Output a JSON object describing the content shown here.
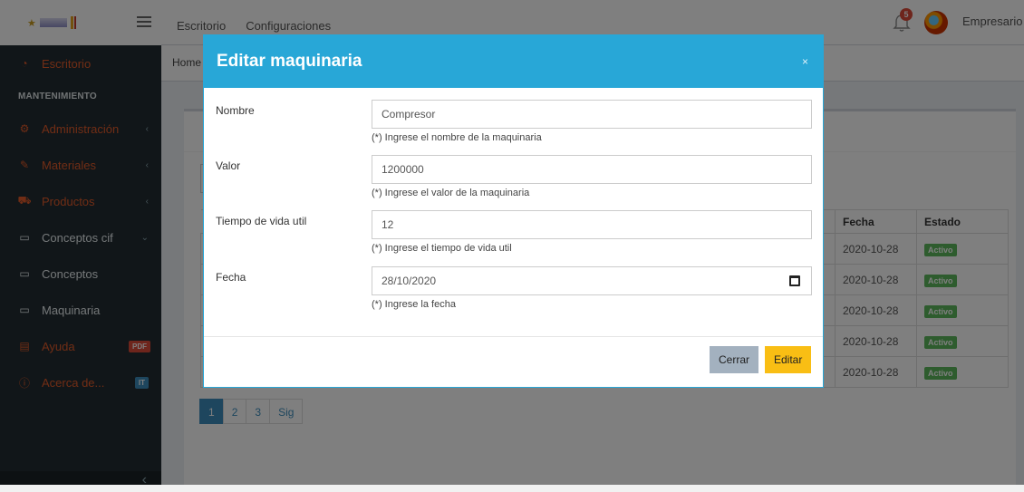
{
  "header": {
    "nav": [
      "Escritorio",
      "Configuraciones"
    ],
    "notification_count": "5",
    "user_label": "Empresario ▾"
  },
  "sidebar": {
    "items": [
      {
        "label": "Escritorio",
        "icon": "dashboard-icon"
      },
      {
        "section": "MANTENIMIENTO"
      },
      {
        "label": "Administración",
        "icon": "gear-icon"
      },
      {
        "label": "Materiales",
        "icon": "brush-icon"
      },
      {
        "label": "Productos",
        "icon": "cart-icon"
      },
      {
        "label": "Conceptos cif",
        "icon": "folder-icon"
      },
      {
        "label": "Conceptos",
        "icon": "folder-icon"
      },
      {
        "label": "Maquinaria",
        "icon": "folder-icon"
      },
      {
        "label": "Ayuda",
        "icon": "book-icon",
        "tag": "PDF"
      },
      {
        "label": "Acerca de...",
        "icon": "info-icon",
        "tag": "IT"
      }
    ]
  },
  "breadcrumb": "Home",
  "table": {
    "headers": [
      "Fecha",
      "Estado"
    ],
    "rows": [
      [
        "2020-10-28",
        "Activo"
      ],
      [
        "2020-10-28",
        "Activo"
      ],
      [
        "2020-10-28",
        "Activo"
      ],
      [
        "2020-10-28",
        "Activo"
      ],
      [
        "2020-10-28",
        "Activo"
      ]
    ]
  },
  "pagination": [
    "1",
    "2",
    "3",
    "Sig"
  ],
  "modal": {
    "title": "Editar maquinaria",
    "close": "×",
    "fields": [
      {
        "label": "Nombre",
        "value": "Compresor",
        "help": "(*) Ingrese el nombre de la maquinaria"
      },
      {
        "label": "Valor",
        "value": "1200000",
        "help": "(*) Ingrese el valor de la maquinaria"
      },
      {
        "label": "Tiempo de vida util",
        "value": "12",
        "help": "(*) Ingrese el tiempo de vida util"
      },
      {
        "label": "Fecha",
        "value": "28/10/2020",
        "help": "(*) Ingrese la fecha"
      }
    ],
    "cancel": "Cerrar",
    "submit": "Editar"
  }
}
